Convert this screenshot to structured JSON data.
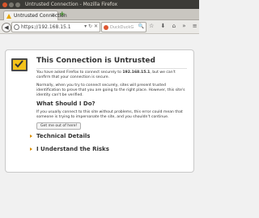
{
  "window": {
    "title": "Untrusted Connection - Mozilla Firefox"
  },
  "tabs": [
    {
      "label": "Untrusted Connection",
      "close": "×"
    }
  ],
  "toolbar": {
    "back_glyph": "◀",
    "url": "https://192.168.15.1",
    "url_icons": "▾ ↻ ✕",
    "search_placeholder": "DuckDuckG",
    "search_icon": "🔍",
    "icons": "☆ ⬇ ⌂ »  ≡",
    "new_tab": "+"
  },
  "page": {
    "title": "This Connection is Untrusted",
    "para1_prefix": "You have asked Firefox to connect securely to ",
    "para1_host": "192.168.15.1",
    "para1_suffix": ", but we can't confirm that your connection is secure.",
    "para2": "Normally, when you try to connect securely, sites will present trusted identification to prove that you are going to the right place. However, this site's identity can't be verified.",
    "heading2": "What Should I Do?",
    "para3": "If you usually connect to this site without problems, this error could mean that someone is trying to impersonate the site, and you shouldn't continue.",
    "button": "Get me out of here!",
    "expander1": "Technical Details",
    "expander2": "I Understand the Risks"
  },
  "colors": {
    "warning": "#e6a500",
    "accent_arrow": "#d98d00"
  }
}
